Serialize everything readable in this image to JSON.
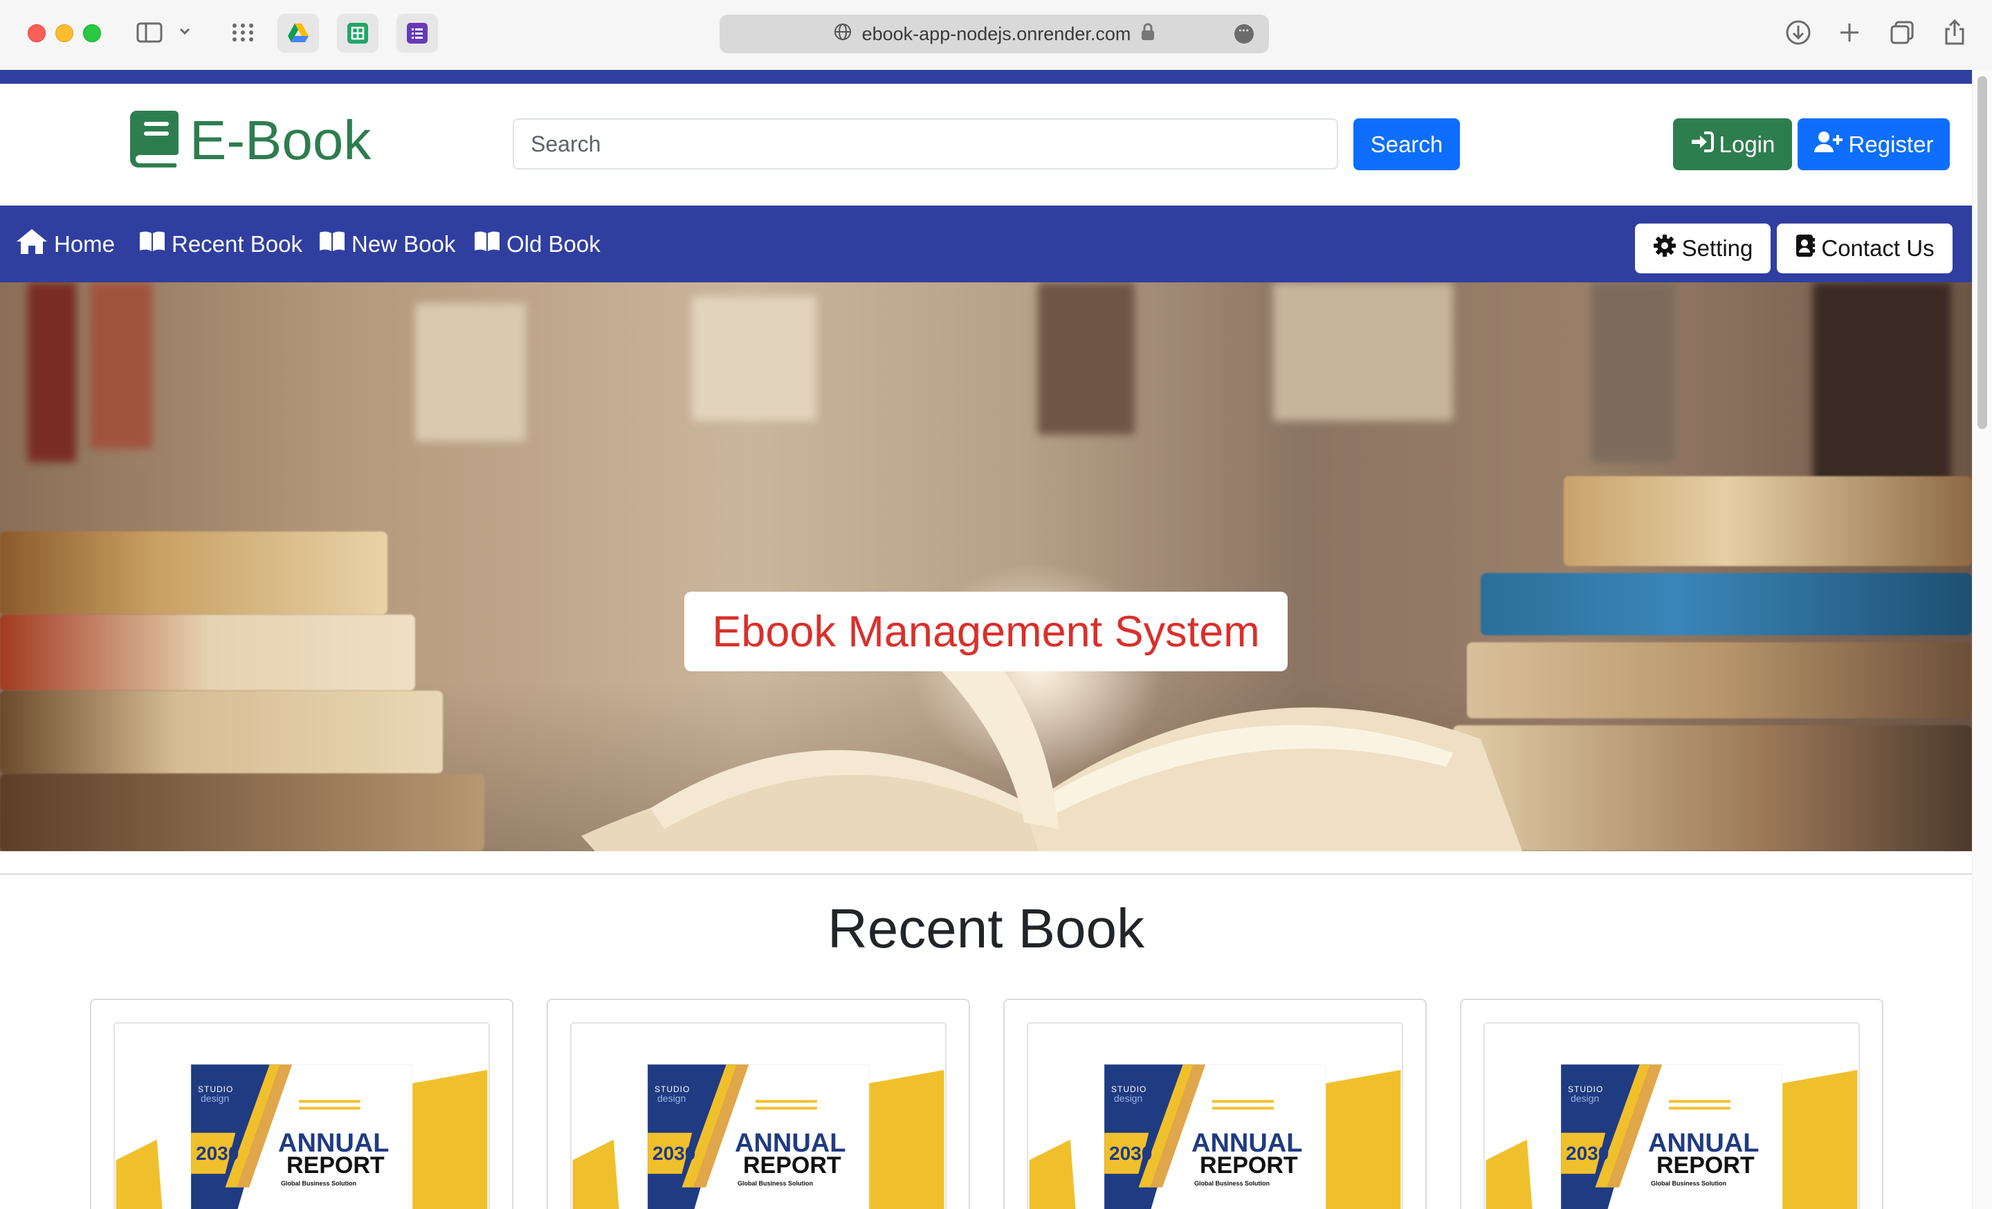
{
  "browser": {
    "url": "ebook-app-nodejs.onrender.com"
  },
  "header": {
    "logo_text": "E-Book",
    "search_placeholder": "Search",
    "search_button": "Search",
    "login_button": "Login",
    "register_button": "Register"
  },
  "nav": {
    "items": [
      {
        "label": "Home",
        "icon": "home-icon"
      },
      {
        "label": "Recent Book",
        "icon": "book-open-icon"
      },
      {
        "label": "New Book",
        "icon": "book-open-icon"
      },
      {
        "label": "Old Book",
        "icon": "book-open-icon"
      }
    ],
    "setting_button": "Setting",
    "contact_button": "Contact Us"
  },
  "hero": {
    "title": "Ebook Management System"
  },
  "recent": {
    "title": "Recent Book",
    "books": [
      {
        "studio": "STUDIO",
        "design": "design",
        "year": "2030",
        "line1": "ANNUAL",
        "line2": "REPORT",
        "sub": "Global Business Solution"
      },
      {
        "studio": "STUDIO",
        "design": "design",
        "year": "2030",
        "line1": "ANNUAL",
        "line2": "REPORT",
        "sub": "Global Business Solution"
      },
      {
        "studio": "STUDIO",
        "design": "design",
        "year": "2030",
        "line1": "ANNUAL",
        "line2": "REPORT",
        "sub": "Global Business Solution"
      },
      {
        "studio": "STUDIO",
        "design": "design",
        "year": "2030",
        "line1": "ANNUAL",
        "line2": "REPORT",
        "sub": "Global Business Solution"
      }
    ]
  },
  "colors": {
    "nav_bg": "#303f9f",
    "brand_green": "#2e7d4f",
    "primary_blue": "#0d6efd",
    "hero_title": "#d9302b",
    "cover_navy": "#1f3b82",
    "cover_yellow": "#f0c02c"
  }
}
